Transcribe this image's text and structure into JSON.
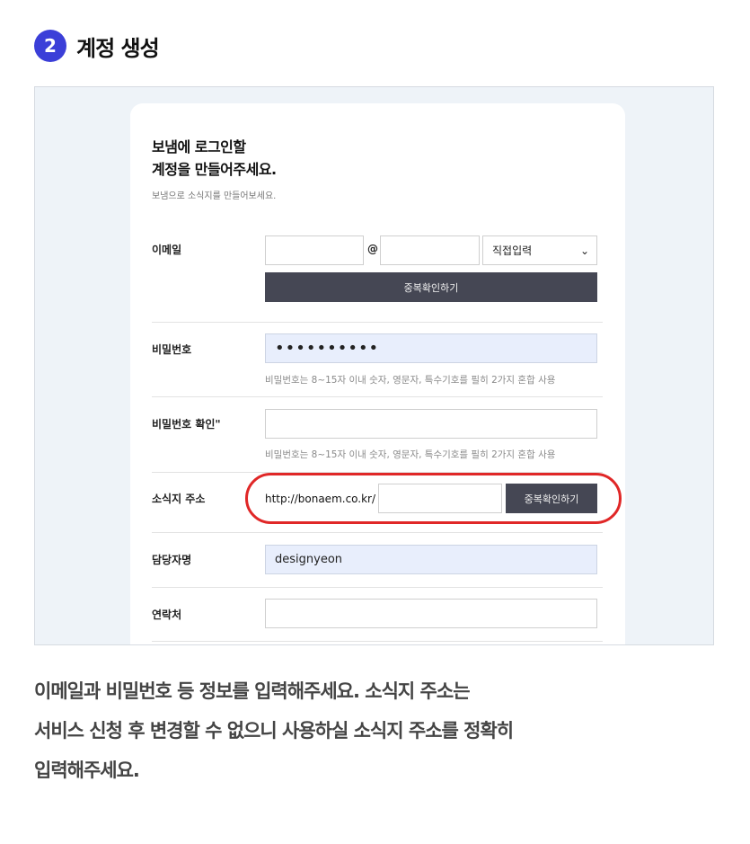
{
  "header": {
    "step_number": "2",
    "title": "계정 생성"
  },
  "form": {
    "heading_line1": "보냄에 로그인할",
    "heading_line2": "계정을 만들어주세요.",
    "subheading": "보냄으로 소식지를 만들어보세요.",
    "email": {
      "label": "이메일",
      "local_value": "",
      "at_sign": "@",
      "domain_value": "",
      "domain_select": "직접입력",
      "check_button": "중복확인하기"
    },
    "password": {
      "label": "비밀번호",
      "value_masked": "••••••••••",
      "hint": "비밀번호는 8~15자 이내 숫자, 영문자, 특수기호를 필히 2가지 혼합 사용"
    },
    "password_confirm": {
      "label": "비밀번호 확인\"",
      "value": "",
      "hint": "비밀번호는 8~15자 이내 숫자, 영문자, 특수기호를 필히 2가지 혼합 사용"
    },
    "newsletter_address": {
      "label": "소식지 주소",
      "prefix": "http://bonaem.co.kr/",
      "value": "",
      "check_button": "중복확인하기"
    },
    "manager_name": {
      "label": "담당자명",
      "value": "designyeon"
    },
    "contact": {
      "label": "연락처",
      "value": ""
    }
  },
  "description": {
    "line1": "이메일과 비밀번호 등 정보를 입력해주세요. 소식지 주소는",
    "line2": "서비스 신청 후 변경할 수 없으니 사용하실 소식지 주소를 정확히",
    "line3": "입력해주세요."
  },
  "colors": {
    "accent": "#3b3fd8",
    "highlight": "#e02727",
    "button": "#454754",
    "autofill": "#e8eefc"
  }
}
